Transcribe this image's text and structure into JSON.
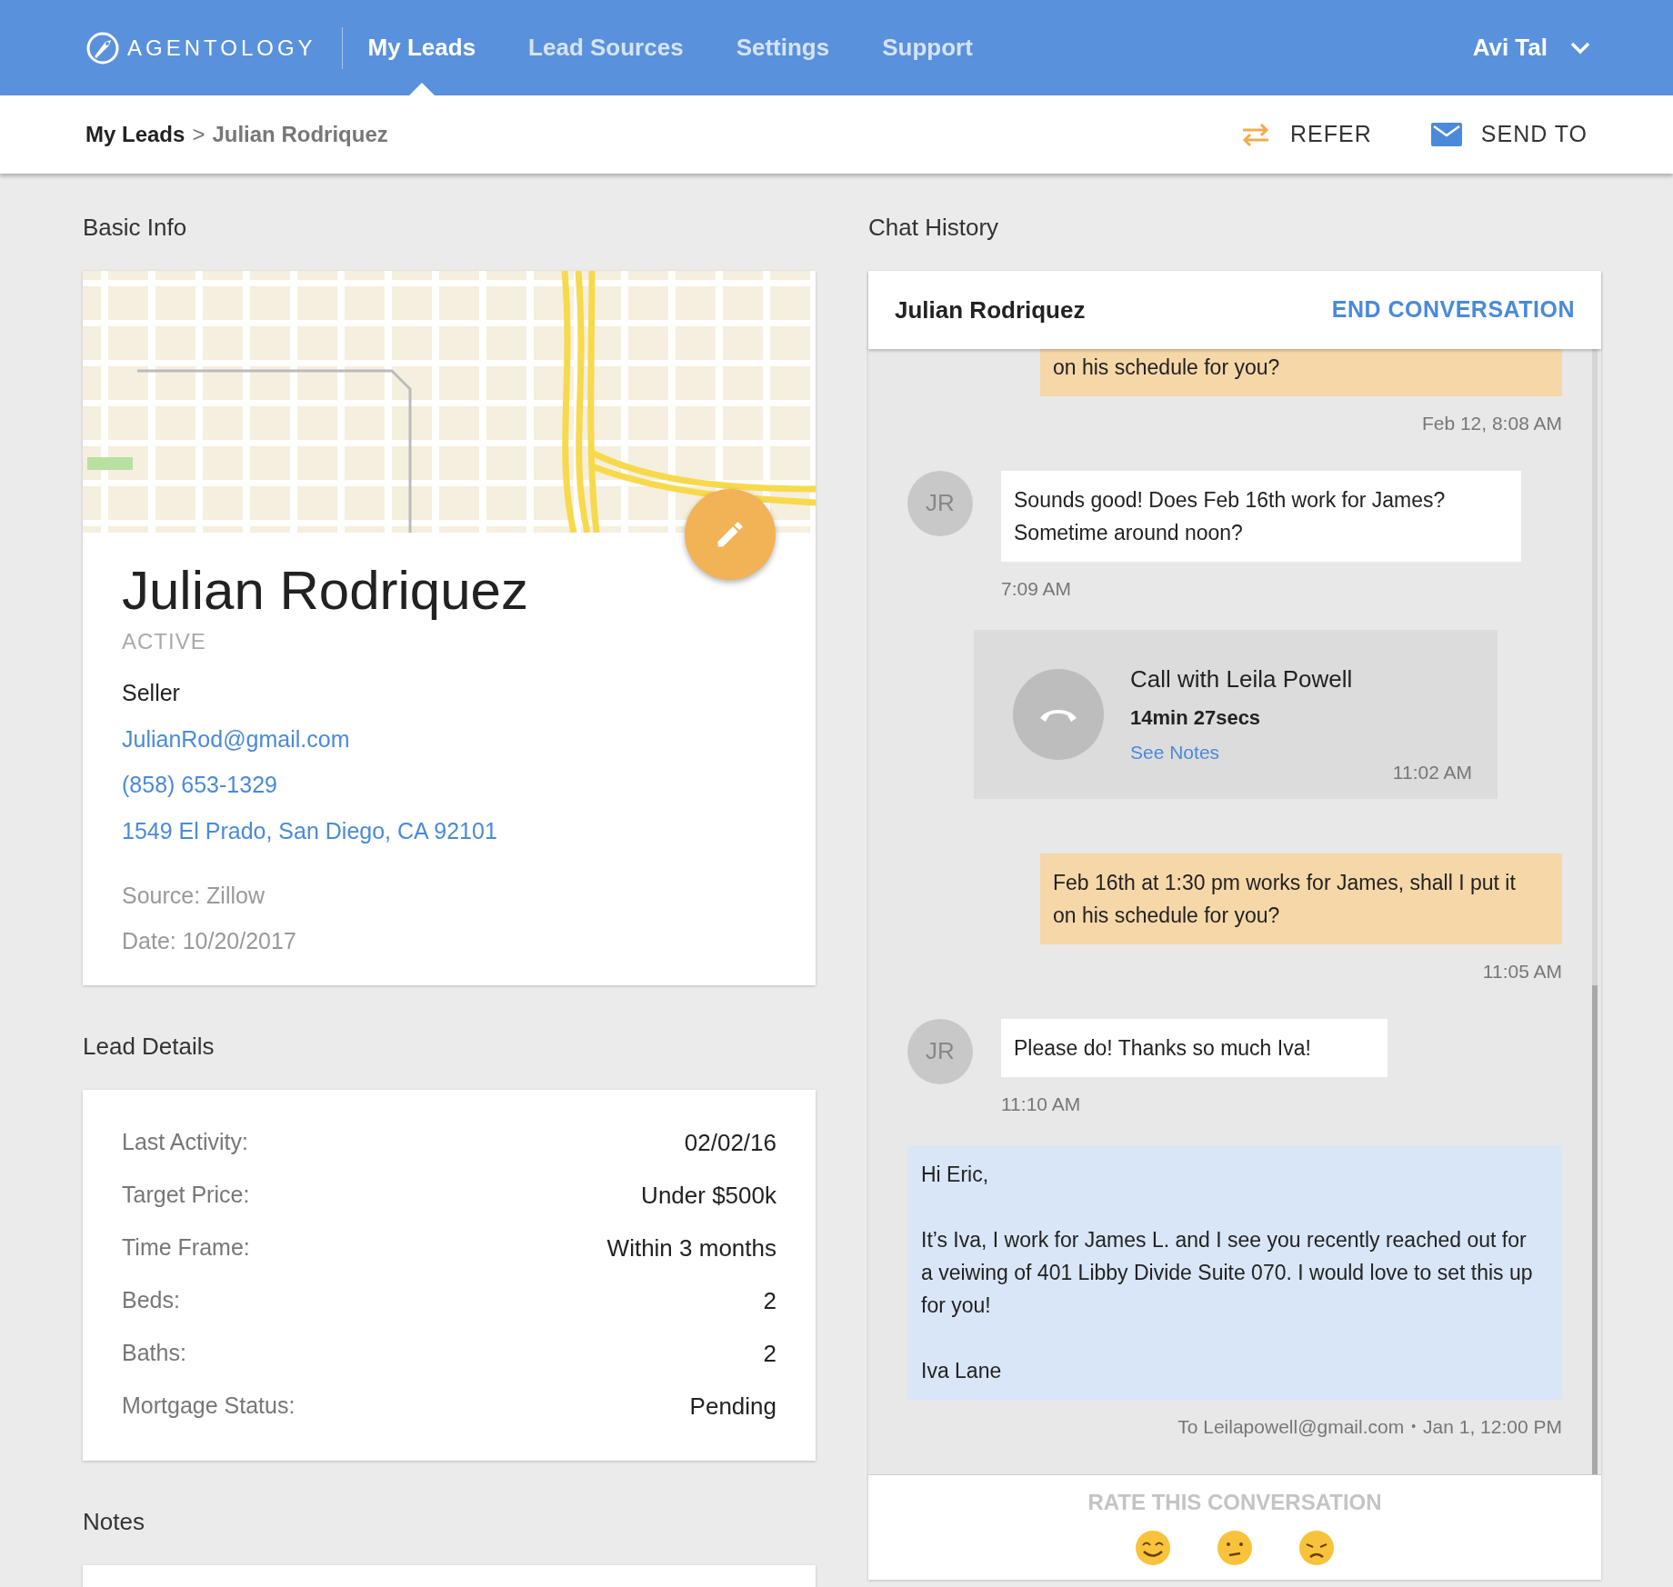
{
  "nav": {
    "logo": "AGENTOLOGY",
    "items": [
      {
        "label": "My Leads",
        "selected": true
      },
      {
        "label": "Lead Sources",
        "selected": false
      },
      {
        "label": "Settings",
        "selected": false
      },
      {
        "label": "Support",
        "selected": false
      }
    ],
    "user": "Avi Tal"
  },
  "breadcrumb": {
    "parent": "My Leads",
    "separator": ">",
    "current": "Julian Rodriquez"
  },
  "actions": [
    {
      "kind": "refer",
      "label": "REFER"
    },
    {
      "kind": "send",
      "label": "SEND TO"
    }
  ],
  "basic_info": {
    "title": "Basic Info",
    "name": "Julian Rodriquez",
    "status": "ACTIVE",
    "role": "Seller",
    "email": "JulianRod@gmail.com",
    "phone": "(858) 653-1329",
    "address": "1549 El Prado, San Diego, CA 92101",
    "source": "Source: Zillow",
    "date": "Date: 10/20/2017"
  },
  "lead_details": {
    "title": "Lead Details",
    "rows": [
      {
        "label": "Last Activity:",
        "value": "02/02/16"
      },
      {
        "label": "Target Price:",
        "value": "Under $500k"
      },
      {
        "label": "Time Frame:",
        "value": "Within 3 months"
      },
      {
        "label": "Beds:",
        "value": "2"
      },
      {
        "label": "Baths:",
        "value": "2"
      },
      {
        "label": "Mortgage Status:",
        "value": "Pending"
      }
    ]
  },
  "notes": {
    "title": "Notes"
  },
  "chat": {
    "title": "Chat History",
    "contact": "Julian Rodriquez",
    "end_button": "END CONVERSATION",
    "messages": [
      {
        "kind": "agent",
        "lines": [
          "on his schedule for you?"
        ],
        "time": "Feb 12, 8:08 AM"
      },
      {
        "kind": "lead",
        "avatar": "JR",
        "lines": [
          "Sounds good! Does Feb 16th work for James?",
          "Sometime around noon?"
        ],
        "time": "7:09 AM"
      },
      {
        "kind": "call",
        "title": "Call with Leila Powell",
        "duration": "14min 27secs",
        "link": "See Notes",
        "time": "11:02 AM"
      },
      {
        "kind": "agent",
        "lines": [
          "Feb 16th at 1:30 pm works for James, shall I put it",
          "on his schedule for you?"
        ],
        "time": "11:05 AM"
      },
      {
        "kind": "lead",
        "avatar": "JR",
        "lines": [
          "Please do! Thanks so much Iva!"
        ],
        "time": "11:10 AM"
      },
      {
        "kind": "email",
        "paragraphs": [
          "Hi Eric,",
          "It’s Iva, I work for James L. and I see you recently reached out for a veiwing of 401 Libby Divide Suite 070. I would love to set this up for you!",
          "Iva Lane"
        ],
        "recipient": "To Leilapowell@gmail.com",
        "separator": "•",
        "time": "Jan 1, 12:00 PM"
      }
    ],
    "rating": {
      "label": "RATE THIS CONVERSATION",
      "faces": [
        {
          "kind": "happy"
        },
        {
          "kind": "neutral"
        },
        {
          "kind": "sad"
        }
      ]
    }
  }
}
